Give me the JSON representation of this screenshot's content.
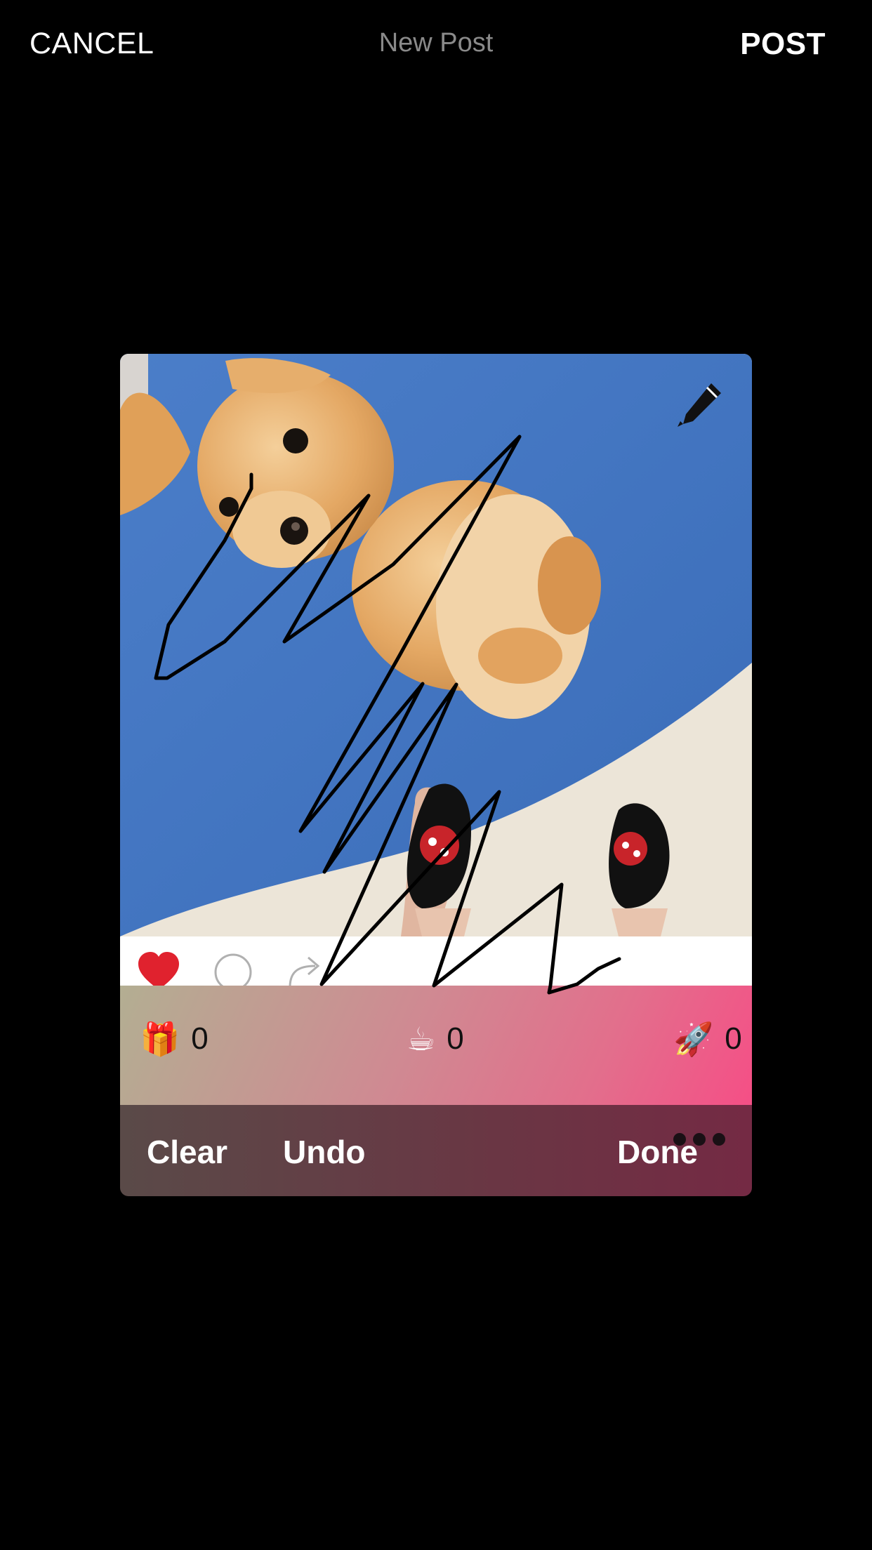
{
  "header": {
    "cancel_label": "CANCEL",
    "title": "New Post",
    "post_label": "POST"
  },
  "stats": [
    {
      "icon": "gift-emoji",
      "glyph": "🎁",
      "count": "0"
    },
    {
      "icon": "coffee-emoji",
      "glyph": "☕",
      "count": "0"
    },
    {
      "icon": "rocket-emoji",
      "glyph": "🚀",
      "count": "0"
    }
  ],
  "toolbar": {
    "clear_label": "Clear",
    "undo_label": "Undo",
    "done_label": "Done"
  },
  "colors": {
    "background": "#000000",
    "stats_gradient_start": "#b3ae92",
    "stats_gradient_end": "#f54f86",
    "toolbar": "#5a4a48",
    "heart": "#e0222e"
  }
}
